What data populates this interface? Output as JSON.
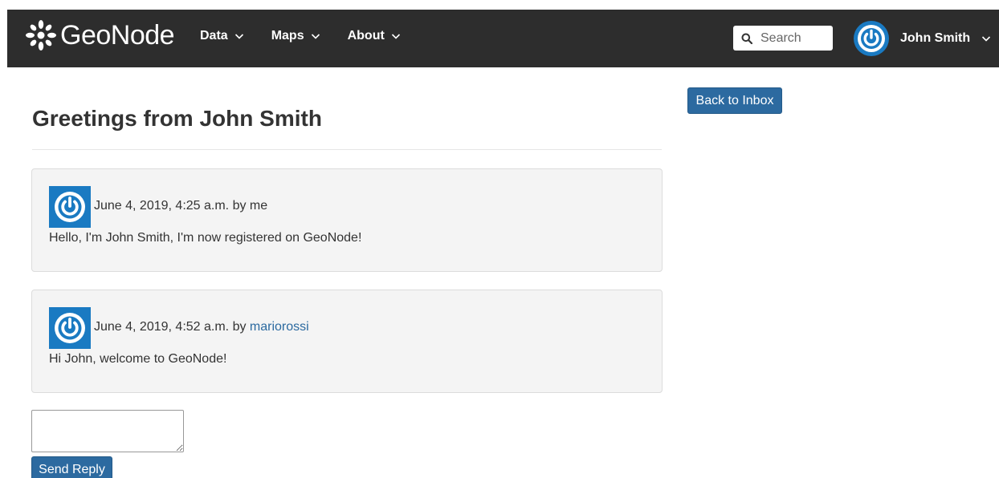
{
  "header": {
    "logo_text": "GeoNode",
    "nav": [
      {
        "label": "Data"
      },
      {
        "label": "Maps"
      },
      {
        "label": "About"
      }
    ],
    "search_placeholder": "Search",
    "user_name": "John Smith"
  },
  "thread": {
    "title": "Greetings from John Smith",
    "back_label": "Back to Inbox",
    "messages": [
      {
        "meta": "June 4, 2019, 4:25 a.m. by me",
        "body": "Hello, I'm John Smith, I'm now registered on GeoNode!"
      },
      {
        "meta_prefix": "June 4, 2019, 4:52 a.m. by ",
        "author": "mariorossi",
        "body": "Hi John, welcome to GeoNode!"
      }
    ],
    "reply_value": "",
    "send_label": "Send Reply"
  },
  "colors": {
    "navbar": "#2d2d2d",
    "accent": "#2c6aa0",
    "avatar_blue": "#1a7ac2",
    "panel": "#f4f4f4"
  },
  "icons": {
    "logo": "geonode-logo-icon",
    "chevron": "chevron-down-icon",
    "search": "search-icon",
    "avatar": "power-avatar-icon"
  }
}
